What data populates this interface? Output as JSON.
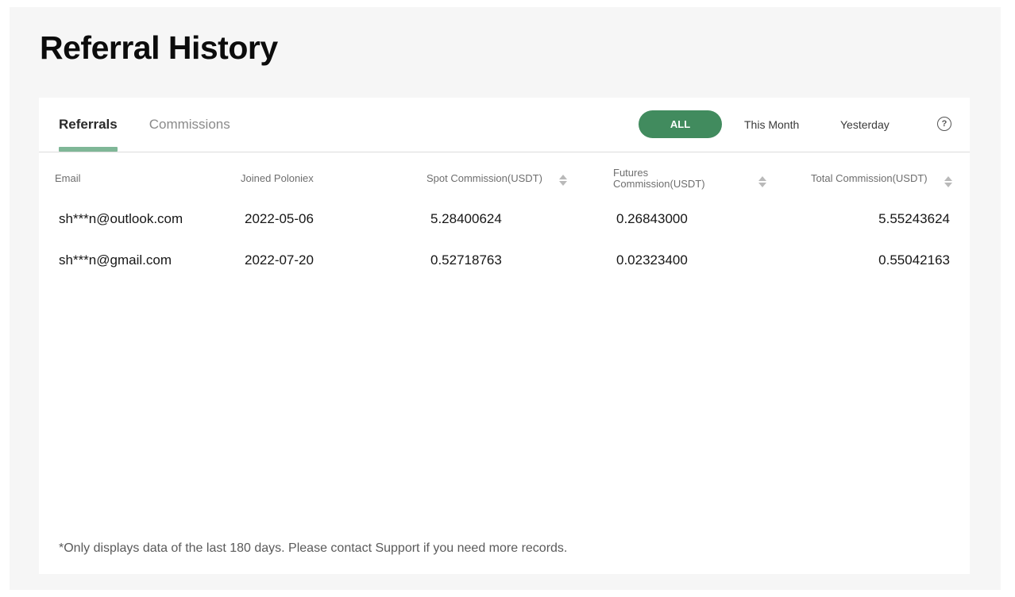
{
  "page": {
    "title": "Referral History"
  },
  "tabs": [
    {
      "label": "Referrals",
      "active": true
    },
    {
      "label": "Commissions",
      "active": false
    }
  ],
  "filters": {
    "all": "ALL",
    "this_month": "This Month",
    "yesterday": "Yesterday",
    "help_icon": "question-circle-icon",
    "selected": "ALL"
  },
  "table": {
    "headers": {
      "email": "Email",
      "joined": "Joined Poloniex",
      "spot": "Spot Commission(USDT)",
      "futures_line1": "Futures",
      "futures_line2": "Commission(USDT)",
      "total": "Total Commission(USDT)"
    },
    "rows": [
      {
        "email": "sh***n@outlook.com",
        "joined": "2022-05-06",
        "spot": "5.28400624",
        "futures": "0.26843000",
        "total": "5.55243624"
      },
      {
        "email": "sh***n@gmail.com",
        "joined": "2022-07-20",
        "spot": "0.52718763",
        "futures": "0.02323400",
        "total": "0.55042163"
      }
    ]
  },
  "footnote": "*Only displays data of the last 180 days. Please contact Support if you need more records.",
  "colors": {
    "accent": "#418b5e",
    "tab_underline": "#7fb797",
    "background": "#f6f6f6"
  }
}
